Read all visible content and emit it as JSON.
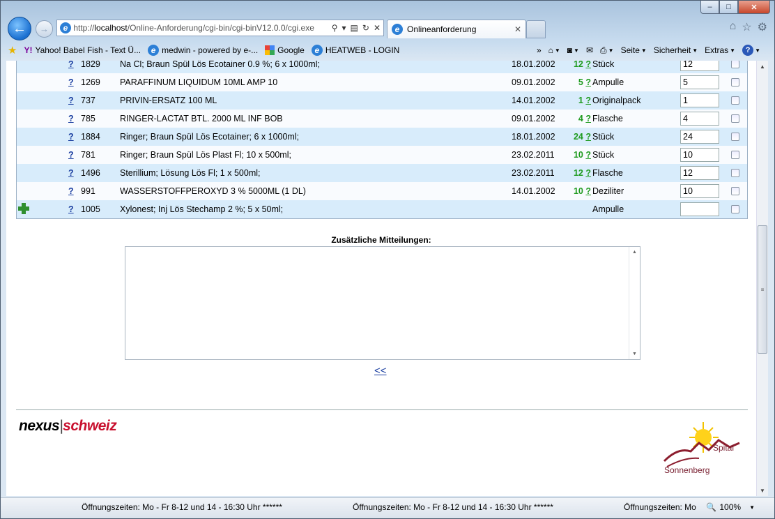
{
  "window": {
    "min": "–",
    "max": "□",
    "close": "✕"
  },
  "browser": {
    "address_prefix": "http://",
    "address_host": "localhost",
    "address_path": "/Online-Anforderung/cgi-bin/cgi-binV12.0.0/cgi.exe",
    "tab_title": "Onlineanforderung"
  },
  "favorites": [
    {
      "label": "Yahoo! Babel Fish - Text Ü..."
    },
    {
      "label": "medwin - powered by e-..."
    },
    {
      "label": "Google"
    },
    {
      "label": "HEATWEB - LOGIN"
    }
  ],
  "commands": {
    "seite": "Seite",
    "sicherheit": "Sicherheit",
    "extras": "Extras"
  },
  "rows": [
    {
      "q": "?",
      "num": "1829",
      "desc": "Na Cl; Braun Spül Lös Ecotainer 0.9 %; 6 x 1000ml;",
      "date": "18.01.2002",
      "count": "12",
      "unit": "Stück",
      "qty": "12",
      "bg": "blue"
    },
    {
      "q": "?",
      "num": "1269",
      "desc": "PARAFFINUM LIQUIDUM 10ML AMP 10",
      "date": "09.01.2002",
      "count": "5",
      "unit": "Ampulle",
      "qty": "5",
      "bg": "white"
    },
    {
      "q": "?",
      "num": "737",
      "desc": "PRIVIN-ERSATZ 100 ML",
      "date": "14.01.2002",
      "count": "1",
      "unit": "Originalpack",
      "qty": "1",
      "bg": "blue"
    },
    {
      "q": "?",
      "num": "785",
      "desc": "RINGER-LACTAT BTL. 2000 ML INF BOB",
      "date": "09.01.2002",
      "count": "4",
      "unit": "Flasche",
      "qty": "4",
      "bg": "white"
    },
    {
      "q": "?",
      "num": "1884",
      "desc": "Ringer; Braun Spül Lös Ecotainer; 6 x 1000ml;",
      "date": "18.01.2002",
      "count": "24",
      "unit": "Stück",
      "qty": "24",
      "bg": "blue"
    },
    {
      "q": "?",
      "num": "781",
      "desc": "Ringer; Braun Spül Lös Plast Fl; 10 x 500ml;",
      "date": "23.02.2011",
      "count": "10",
      "unit": "Stück",
      "qty": "10",
      "bg": "white"
    },
    {
      "q": "?",
      "num": "1496",
      "desc": "Sterillium; Lösung Lös Fl; 1 x 500ml;",
      "date": "23.02.2011",
      "count": "12",
      "unit": "Flasche",
      "qty": "12",
      "bg": "blue"
    },
    {
      "q": "?",
      "num": "991",
      "desc": "WASSERSTOFFPEROXYD 3 % 5000ML (1 DL)",
      "date": "14.01.2002",
      "count": "10",
      "unit": "Deziliter",
      "qty": "10",
      "bg": "white"
    },
    {
      "q": "?",
      "num": "1005",
      "desc": "Xylonest; Inj Lös Stechamp 2 %; 5 x 50ml;",
      "date": "",
      "count": "",
      "unit": "Ampulle",
      "qty": "",
      "bg": "blue",
      "plus": true
    }
  ],
  "count_q": "?",
  "message": {
    "label": "Zusätzliche Mitteilungen:",
    "back": "<<"
  },
  "footer": {
    "brand1": "nexus",
    "sep": "|",
    "brand2": "schweiz",
    "logo_top": "Spital",
    "logo_bottom": "Sonnenberg"
  },
  "status": {
    "s1": "Öffnungszeiten: Mo - Fr 8-12 und 14 - 16:30 Uhr ******",
    "s2": "Öffnungszeiten: Mo - Fr 8-12 und 14 - 16:30 Uhr ******",
    "s3": "Öffnungszeiten: Mo",
    "zoom": "100%"
  }
}
